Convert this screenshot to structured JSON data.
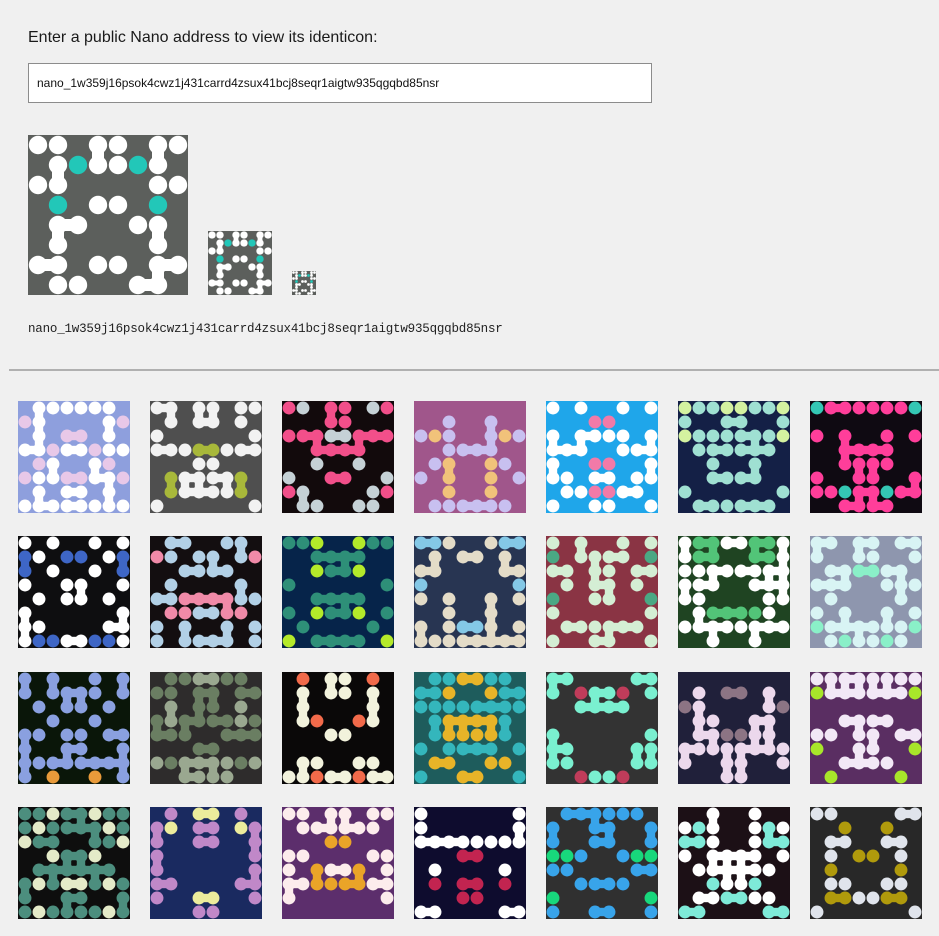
{
  "prompt_label": "Enter a public Nano address to view its identicon:",
  "address_input_value": "nano_1w359j16psok4cwz1j431carrd4zsux41bcj8seqr1aigtw935qgqbd85nsr",
  "address_display": "nano_1w359j16psok4cwz1j431carrd4zsux41bcj8seqr1aigtw935qgqbd85nsr",
  "preview": {
    "bg": "#5c5f5c",
    "fg": "#ffffff",
    "accent": "#22c7b8",
    "sizes": [
      160,
      64,
      24
    ]
  },
  "gallery": [
    {
      "bg": "#8e9fdd",
      "fg": "#ffffff",
      "accent": "#e8c8e8",
      "seed": 1
    },
    {
      "bg": "#4f4f4f",
      "fg": "#f2f2f2",
      "accent": "#a8b83a",
      "seed": 2
    },
    {
      "bg": "#120a0c",
      "fg": "#c5d1d6",
      "accent": "#f24f8a",
      "seed": 3
    },
    {
      "bg": "#a0568b",
      "fg": "#c8c0f0",
      "accent": "#f1c27a",
      "seed": 4
    },
    {
      "bg": "#1fa6ea",
      "fg": "#ffffff",
      "accent": "#f27aa8",
      "seed": 5
    },
    {
      "bg": "#142046",
      "fg": "#9fe0d2",
      "accent": "#d4f2a0",
      "seed": 6
    },
    {
      "bg": "#0f0a12",
      "fg": "#ff3e9a",
      "accent": "#34c7b4",
      "seed": 7
    },
    {
      "bg": "#0e0e10",
      "fg": "#ffffff",
      "accent": "#3e66c6",
      "seed": 8
    },
    {
      "bg": "#130e10",
      "fg": "#b2d0e6",
      "accent": "#f08aa8",
      "seed": 9
    },
    {
      "bg": "#06244a",
      "fg": "#2e8f78",
      "accent": "#b4ea2a",
      "seed": 10
    },
    {
      "bg": "#283552",
      "fg": "#e4dcc8",
      "accent": "#84c8e6",
      "seed": 11
    },
    {
      "bg": "#8a3444",
      "fg": "#d4eed4",
      "accent": "#4aa884",
      "seed": 12
    },
    {
      "bg": "#1f4422",
      "fg": "#ffffff",
      "accent": "#52c478",
      "seed": 13
    },
    {
      "bg": "#8e96ae",
      "fg": "#d8f4f4",
      "accent": "#8af0c8",
      "seed": 14
    },
    {
      "bg": "#0a1609",
      "fg": "#8aa0e0",
      "accent": "#e89a3a",
      "seed": 15
    },
    {
      "bg": "#2e2c2c",
      "fg": "#6a7e62",
      "accent": "#9aa890",
      "seed": 16
    },
    {
      "bg": "#0a0808",
      "fg": "#f2f2dc",
      "accent": "#f26a4a",
      "seed": 17
    },
    {
      "bg": "#1e5c5c",
      "fg": "#34b6bc",
      "accent": "#e8b428",
      "seed": 18
    },
    {
      "bg": "#333333",
      "fg": "#7af0d0",
      "accent": "#c03c5a",
      "seed": 19
    },
    {
      "bg": "#20203a",
      "fg": "#ecd8ec",
      "accent": "#8c7484",
      "seed": 20
    },
    {
      "bg": "#5a2e62",
      "fg": "#f2e8f6",
      "accent": "#a8e62a",
      "seed": 21
    },
    {
      "bg": "#0e0e0e",
      "fg": "#4c8e7e",
      "accent": "#e4eac8",
      "seed": 22
    },
    {
      "bg": "#1a2a60",
      "fg": "#c088c8",
      "accent": "#ecec9c",
      "seed": 23
    },
    {
      "bg": "#5c2e6c",
      "fg": "#fcecec",
      "accent": "#eaa428",
      "seed": 24
    },
    {
      "bg": "#0e0c2e",
      "fg": "#ffffff",
      "accent": "#c22450",
      "seed": 25
    },
    {
      "bg": "#303030",
      "fg": "#38a4ea",
      "accent": "#18d87c",
      "seed": 26
    },
    {
      "bg": "#1c1016",
      "fg": "#ffffff",
      "accent": "#7eead8",
      "seed": 27
    },
    {
      "bg": "#282828",
      "fg": "#e0e4ec",
      "accent": "#b09a0c",
      "seed": 28
    }
  ]
}
